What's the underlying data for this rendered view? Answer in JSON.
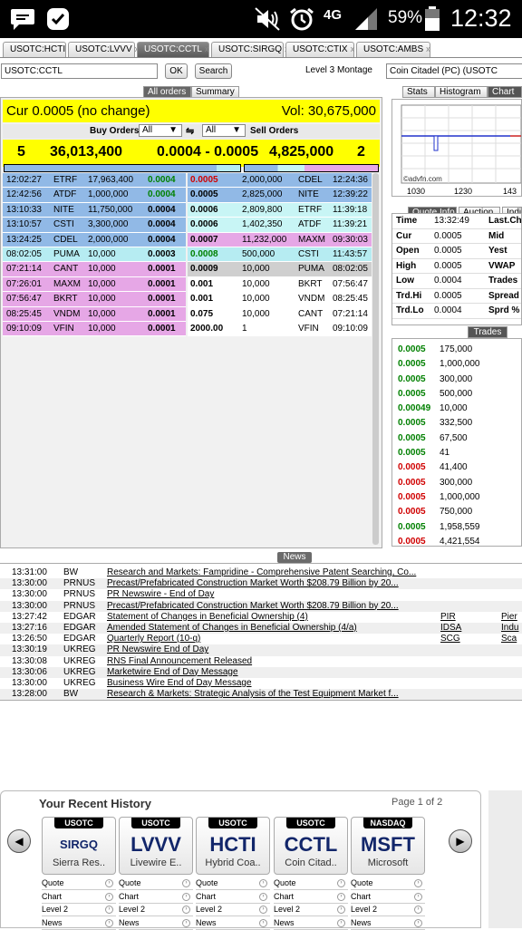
{
  "statusbar": {
    "battery": "59%",
    "time": "12:32",
    "network": "4G"
  },
  "tabs": [
    {
      "label": "USOTC:HCTI",
      "active": false
    },
    {
      "label": "USOTC:LVVV",
      "active": false
    },
    {
      "label": "USOTC:CCTL",
      "active": true
    },
    {
      "label": "USOTC:SIRGQ",
      "active": false
    },
    {
      "label": "USOTC:CTIX",
      "active": false
    },
    {
      "label": "USOTC:AMBS",
      "active": false
    }
  ],
  "search": {
    "value": "USOTC:CCTL",
    "ok_label": "OK",
    "search_label": "Search",
    "montage_label": "Level 3 Montage",
    "company": "Coin Citadel (PC) (USOTC"
  },
  "subtabs": {
    "all_orders": "All orders",
    "summary": "Summary"
  },
  "summary": {
    "cur": "Cur 0.0005 (no change)",
    "vol": "Vol: 30,675,000"
  },
  "filters": {
    "buy_label": "Buy Orders",
    "all1": "All",
    "all2": "All",
    "sell_label": "Sell Orders"
  },
  "quote": {
    "bid_count": "5",
    "bid_size": "36,013,400",
    "spread": "0.0004 - 0.0005",
    "ask_size": "4,825,000",
    "ask_count": "2"
  },
  "colors": {
    "blue": "#91b9e6",
    "lightblue": "#b6ecf2",
    "cyan": "#c8f5f5",
    "pink": "#e6a7e6",
    "gray": "#cfcfcf",
    "white": "#ffffff",
    "green": "#008000",
    "red": "#d00000",
    "yellow": "#ffff00"
  },
  "buy_orders": [
    {
      "time": "12:02:27",
      "mm": "ETRF",
      "size": "17,963,400",
      "price": "0.0004",
      "color": "blue",
      "pc": "green"
    },
    {
      "time": "12:42:56",
      "mm": "ATDF",
      "size": "1,000,000",
      "price": "0.0004",
      "color": "blue",
      "pc": "green"
    },
    {
      "time": "13:10:33",
      "mm": "NITE",
      "size": "11,750,000",
      "price": "0.0004",
      "color": "blue",
      "pc": "black"
    },
    {
      "time": "13:10:57",
      "mm": "CSTI",
      "size": "3,300,000",
      "price": "0.0004",
      "color": "blue",
      "pc": "black"
    },
    {
      "time": "13:24:25",
      "mm": "CDEL",
      "size": "2,000,000",
      "price": "0.0004",
      "color": "blue",
      "pc": "black"
    },
    {
      "time": "08:02:05",
      "mm": "PUMA",
      "size": "10,000",
      "price": "0.0003",
      "color": "lightblue",
      "pc": "black"
    },
    {
      "time": "07:21:14",
      "mm": "CANT",
      "size": "10,000",
      "price": "0.0001",
      "color": "pink",
      "pc": "black"
    },
    {
      "time": "07:26:01",
      "mm": "MAXM",
      "size": "10,000",
      "price": "0.0001",
      "color": "pink",
      "pc": "black"
    },
    {
      "time": "07:56:47",
      "mm": "BKRT",
      "size": "10,000",
      "price": "0.0001",
      "color": "pink",
      "pc": "black"
    },
    {
      "time": "08:25:45",
      "mm": "VNDM",
      "size": "10,000",
      "price": "0.0001",
      "color": "pink",
      "pc": "black"
    },
    {
      "time": "09:10:09",
      "mm": "VFIN",
      "size": "10,000",
      "price": "0.0001",
      "color": "pink",
      "pc": "black"
    }
  ],
  "sell_orders": [
    {
      "price": "0.0005",
      "size": "2,000,000",
      "mm": "CDEL",
      "time": "12:24:36",
      "color": "blue",
      "pc": "red"
    },
    {
      "price": "0.0005",
      "size": "2,825,000",
      "mm": "NITE",
      "time": "12:39:22",
      "color": "blue",
      "pc": "black"
    },
    {
      "price": "0.0006",
      "size": "2,809,800",
      "mm": "ETRF",
      "time": "11:39:18",
      "color": "cyan",
      "pc": "black"
    },
    {
      "price": "0.0006",
      "size": "1,402,350",
      "mm": "ATDF",
      "time": "11:39:21",
      "color": "cyan",
      "pc": "black"
    },
    {
      "price": "0.0007",
      "size": "11,232,000",
      "mm": "MAXM",
      "time": "09:30:03",
      "color": "pink",
      "pc": "black"
    },
    {
      "price": "0.0008",
      "size": "500,000",
      "mm": "CSTI",
      "time": "11:43:57",
      "color": "lightblue",
      "pc": "green"
    },
    {
      "price": "0.0009",
      "size": "10,000",
      "mm": "PUMA",
      "time": "08:02:05",
      "color": "gray",
      "pc": "black"
    },
    {
      "price": "0.001",
      "size": "10,000",
      "mm": "BKRT",
      "time": "07:56:47",
      "color": "white",
      "pc": "black"
    },
    {
      "price": "0.001",
      "size": "10,000",
      "mm": "VNDM",
      "time": "08:25:45",
      "color": "white",
      "pc": "black"
    },
    {
      "price": "0.075",
      "size": "10,000",
      "mm": "CANT",
      "time": "07:21:14",
      "color": "white",
      "pc": "black"
    },
    {
      "price": "2000.00",
      "size": "1",
      "mm": "VFIN",
      "time": "09:10:09",
      "color": "white",
      "pc": "black"
    }
  ],
  "right_tabs": {
    "stats": "Stats",
    "histogram": "Histogram",
    "chart": "Chart"
  },
  "chart": {
    "x_labels": [
      "1030",
      "1230",
      "143"
    ],
    "watermark": "©advfn.com"
  },
  "quote_tabs": {
    "info": "Quote Info",
    "auction": "Auction",
    "indi": "Indi"
  },
  "quote_info": [
    {
      "label": "Time",
      "value": "13:32:49",
      "extra": "Last.Chg"
    },
    {
      "label": "Cur",
      "value": "0.0005",
      "extra": "Mid"
    },
    {
      "label": "Open",
      "value": "0.0005",
      "extra": "Yest"
    },
    {
      "label": "High",
      "value": "0.0005",
      "extra": "VWAP"
    },
    {
      "label": "Low",
      "value": "0.0004",
      "extra": "Trades"
    },
    {
      "label": "Trd.Hi",
      "value": "0.0005",
      "extra": "Spread"
    },
    {
      "label": "Trd.Lo",
      "value": "0.0004",
      "extra": "Sprd %"
    }
  ],
  "trades_label": "Trades",
  "trades": [
    {
      "price": "0.0005",
      "size": "175,000",
      "pc": "green"
    },
    {
      "price": "0.0005",
      "size": "1,000,000",
      "pc": "green"
    },
    {
      "price": "0.0005",
      "size": "300,000",
      "pc": "green"
    },
    {
      "price": "0.0005",
      "size": "500,000",
      "pc": "green"
    },
    {
      "price": "0.00049",
      "size": "10,000",
      "pc": "green"
    },
    {
      "price": "0.0005",
      "size": "332,500",
      "pc": "green"
    },
    {
      "price": "0.0005",
      "size": "67,500",
      "pc": "green"
    },
    {
      "price": "0.0005",
      "size": "41",
      "pc": "green"
    },
    {
      "price": "0.0005",
      "size": "41,400",
      "pc": "red"
    },
    {
      "price": "0.0005",
      "size": "300,000",
      "pc": "red"
    },
    {
      "price": "0.0005",
      "size": "1,000,000",
      "pc": "red"
    },
    {
      "price": "0.0005",
      "size": "750,000",
      "pc": "red"
    },
    {
      "price": "0.0005",
      "size": "1,958,559",
      "pc": "green"
    },
    {
      "price": "0.0005",
      "size": "4,421,554",
      "pc": "red"
    }
  ],
  "news_label": "News",
  "news": [
    {
      "time": "13:31:00",
      "src": "BW",
      "headline": "Research and Markets: Fampridine - Comprehensive Patent Searching, Co...",
      "t1": "",
      "t2": ""
    },
    {
      "time": "13:30:00",
      "src": "PRNUS",
      "headline": "Precast/Prefabricated Construction Market Worth $208.79 Billion by 20...",
      "t1": "",
      "t2": ""
    },
    {
      "time": "13:30:00",
      "src": "PRNUS",
      "headline": "PR Newswire - End of Day",
      "t1": "",
      "t2": ""
    },
    {
      "time": "13:30:00",
      "src": "PRNUS",
      "headline": "Precast/Prefabricated Construction Market Worth $208.79 Billion by 20...",
      "t1": "",
      "t2": ""
    },
    {
      "time": "13:27:42",
      "src": "EDGAR",
      "headline": "Statement of Changes in Beneficial Ownership (4)",
      "t1": "PIR",
      "t2": "Pier"
    },
    {
      "time": "13:27:16",
      "src": "EDGAR",
      "headline": "Amended Statement of Changes in Beneficial Ownership (4/a)",
      "t1": "IDSA",
      "t2": "Indu"
    },
    {
      "time": "13:26:50",
      "src": "EDGAR",
      "headline": "Quarterly Report (10-q)",
      "t1": "SCG",
      "t2": "Sca"
    },
    {
      "time": "13:30:19",
      "src": "UKREG",
      "headline": "PR Newswire End of Day",
      "t1": "",
      "t2": ""
    },
    {
      "time": "13:30:08",
      "src": "UKREG",
      "headline": "RNS Final Announcement Released",
      "t1": "",
      "t2": ""
    },
    {
      "time": "13:30:06",
      "src": "UKREG",
      "headline": "Marketwire End of Day Message",
      "t1": "",
      "t2": ""
    },
    {
      "time": "13:30:00",
      "src": "UKREG",
      "headline": "Business Wire End of Day Message",
      "t1": "",
      "t2": ""
    },
    {
      "time": "13:28:00",
      "src": "BW",
      "headline": "Research & Markets: Strategic Analysis of the Test Equipment Market f...",
      "t1": "",
      "t2": ""
    }
  ],
  "history": {
    "title": "Your Recent History",
    "page": "Page 1 of 2",
    "cards": [
      {
        "ex": "USOTC",
        "sym": "SIRGQ",
        "name": "Sierra Res..",
        "small": true
      },
      {
        "ex": "USOTC",
        "sym": "LVVV",
        "name": "Livewire E..",
        "small": false
      },
      {
        "ex": "USOTC",
        "sym": "HCTI",
        "name": "Hybrid Coa..",
        "small": false
      },
      {
        "ex": "USOTC",
        "sym": "CCTL",
        "name": "Coin Citad..",
        "small": false
      },
      {
        "ex": "NASDAQ",
        "sym": "MSFT",
        "name": "Microsoft",
        "small": false
      }
    ],
    "links": [
      "Quote",
      "Chart",
      "Level 2",
      "News"
    ]
  }
}
